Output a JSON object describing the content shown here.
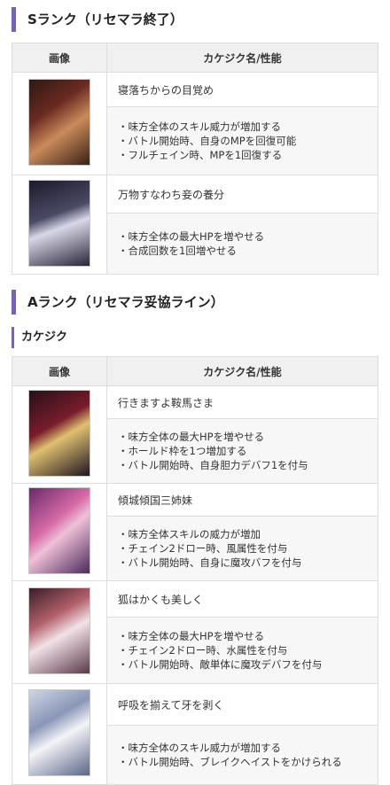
{
  "s_rank": {
    "heading": "Sランク（リセマラ終了）",
    "table": {
      "col_image": "画像",
      "col_name": "カケジク名/性能",
      "rows": [
        {
          "name": "寝落ちからの目覚め",
          "effects": [
            "・味方全体のスキル威力が増加する",
            "・バトル開始時、自身のMPを回復可能",
            "・フルチェイン時、MPを1回復する"
          ]
        },
        {
          "name": "万物すなわち妾の養分",
          "effects": [
            "・味方全体の最大HPを増やせる",
            "・合成回数を1回増やせる"
          ]
        }
      ]
    }
  },
  "a_rank": {
    "heading": "Aランク（リセマラ妥協ライン）",
    "subheading": "カケジク",
    "table": {
      "col_image": "画像",
      "col_name": "カケジク名/性能",
      "rows": [
        {
          "name": "行きますよ鞍馬さま",
          "effects": [
            "・味方全体の最大HPを増やせる",
            "・ホールド枠を1つ増加する",
            "・バトル開始時、自身胆力デバフ1を付与"
          ]
        },
        {
          "name": "傾城傾国三姉妹",
          "effects": [
            "・味方全体スキルの威力が増加",
            "・チェイン2ドロー時、風属性を付与",
            "・バトル開始時、自身に魔攻バフを付与"
          ]
        },
        {
          "name": "狐はかくも美しく",
          "effects": [
            "・味方全体の最大HPを増やせる",
            "・チェイン2ドロー時、水属性を付与",
            "・バトル開始時、敵単体に魔攻デバフを付与"
          ]
        },
        {
          "name": "呼吸を揃えて牙を剥く",
          "effects": [
            "・味方全体のスキル威力が増加する",
            "・バトル開始時、ブレイクヘイストをかけられる"
          ]
        }
      ]
    }
  }
}
